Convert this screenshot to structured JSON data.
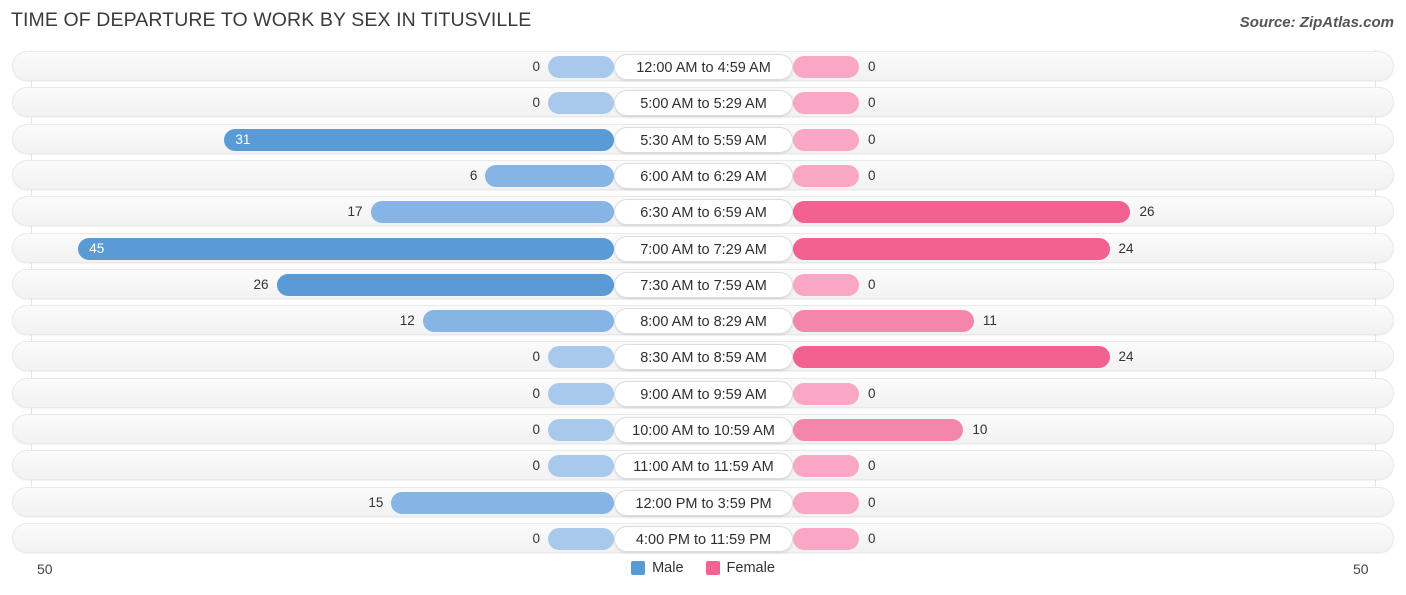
{
  "header": {
    "title": "TIME OF DEPARTURE TO WORK BY SEX IN TITUSVILLE",
    "source": "Source: ZipAtlas.com"
  },
  "legend": {
    "items": [
      {
        "label": "Male",
        "color": "#5b9bd5"
      },
      {
        "label": "Female",
        "color": "#f2618f"
      }
    ]
  },
  "axis": {
    "left_label": "50",
    "right_label": "50"
  },
  "colors": {
    "male_strong": "#5b9bd5",
    "male_mid": "#86b4e4",
    "male_light": "#a9c9ec",
    "female_strong": "#f2618f",
    "female_mid": "#f486ab",
    "female_light": "#f9a7c4",
    "row_background": "#f6f6f6",
    "gridline": "#e6e6e6"
  },
  "chart_data": {
    "type": "bar",
    "orientation": "horizontal-diverging",
    "title": "TIME OF DEPARTURE TO WORK BY SEX IN TITUSVILLE",
    "xlabel": "",
    "ylabel": "",
    "xlim": [
      50,
      0,
      50
    ],
    "axis_max": 50,
    "grid": true,
    "legend_position": "bottom-center",
    "categories": [
      "12:00 AM to 4:59 AM",
      "5:00 AM to 5:29 AM",
      "5:30 AM to 5:59 AM",
      "6:00 AM to 6:29 AM",
      "6:30 AM to 6:59 AM",
      "7:00 AM to 7:29 AM",
      "7:30 AM to 7:59 AM",
      "8:00 AM to 8:29 AM",
      "8:30 AM to 8:59 AM",
      "9:00 AM to 9:59 AM",
      "10:00 AM to 10:59 AM",
      "11:00 AM to 11:59 AM",
      "12:00 PM to 3:59 PM",
      "4:00 PM to 11:59 PM"
    ],
    "series": [
      {
        "name": "Male",
        "color": "#5b9bd5",
        "values": [
          0,
          0,
          31,
          6,
          17,
          45,
          26,
          12,
          0,
          0,
          0,
          0,
          15,
          0
        ],
        "labels": [
          "0",
          "0",
          "31",
          "6",
          "17",
          "45",
          "26",
          "12",
          "0",
          "0",
          "0",
          "0",
          "15",
          "0"
        ]
      },
      {
        "name": "Female",
        "color": "#f2618f",
        "values": [
          0,
          0,
          0,
          0,
          26,
          24,
          0,
          11,
          24,
          0,
          10,
          0,
          0,
          0
        ],
        "labels": [
          "0",
          "0",
          "0",
          "0",
          "26",
          "24",
          "0",
          "11",
          "24",
          "0",
          "10",
          "0",
          "0",
          "0"
        ]
      }
    ]
  }
}
